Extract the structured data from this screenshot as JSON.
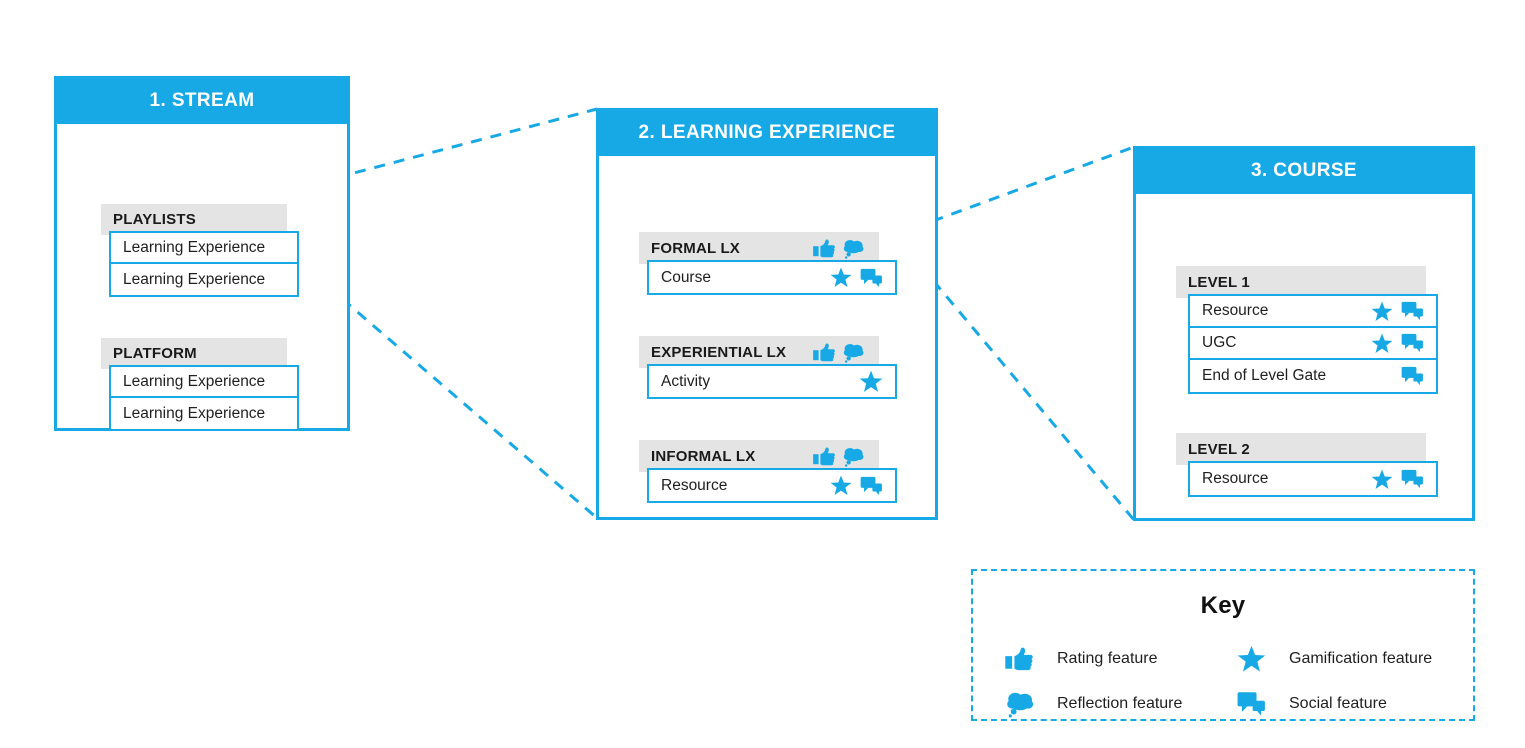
{
  "colors": {
    "brand_blue": "#16A9E6",
    "gray_bar": "#E4E4E4",
    "text_dark": "#1f1f1f",
    "white": "#ffffff"
  },
  "panels": [
    {
      "id": "stream",
      "title": "1. STREAM",
      "groups": [
        {
          "label": "PLAYLISTS",
          "icons": [],
          "items": [
            {
              "text": "Learning Experience",
              "icons": []
            },
            {
              "text": "Learning Experience",
              "icons": []
            }
          ]
        },
        {
          "label": "PLATFORM",
          "icons": [],
          "items": [
            {
              "text": "Learning Experience",
              "icons": []
            },
            {
              "text": "Learning Experience",
              "icons": []
            }
          ]
        }
      ]
    },
    {
      "id": "learning-experience",
      "title": "2. LEARNING EXPERIENCE",
      "groups": [
        {
          "label": "FORMAL LX",
          "icons": [
            "rating-thumbs-up-icon",
            "reflection-cloud-icon"
          ],
          "items": [
            {
              "text": "Course",
              "icons": [
                "gamification-star-icon",
                "social-chat-icon"
              ]
            }
          ]
        },
        {
          "label": "EXPERIENTIAL LX",
          "icons": [
            "rating-thumbs-up-icon",
            "reflection-cloud-icon"
          ],
          "items": [
            {
              "text": "Activity",
              "icons": [
                "gamification-star-icon"
              ]
            }
          ]
        },
        {
          "label": "INFORMAL LX",
          "icons": [
            "rating-thumbs-up-icon",
            "reflection-cloud-icon"
          ],
          "items": [
            {
              "text": "Resource",
              "icons": [
                "gamification-star-icon",
                "social-chat-icon"
              ]
            }
          ]
        }
      ]
    },
    {
      "id": "course",
      "title": "3. COURSE",
      "groups": [
        {
          "label": "LEVEL 1",
          "icons": [],
          "items": [
            {
              "text": "Resource",
              "icons": [
                "gamification-star-icon",
                "social-chat-icon"
              ]
            },
            {
              "text": "UGC",
              "icons": [
                "gamification-star-icon",
                "social-chat-icon"
              ]
            },
            {
              "text": "End of Level Gate",
              "icons": [
                "social-chat-icon"
              ]
            }
          ]
        },
        {
          "label": "LEVEL 2",
          "icons": [],
          "items": [
            {
              "text": "Resource",
              "icons": [
                "gamification-star-icon",
                "social-chat-icon"
              ]
            }
          ]
        }
      ]
    }
  ],
  "key": {
    "title": "Key",
    "entries": [
      {
        "icon": "rating-thumbs-up-icon",
        "label": "Rating feature"
      },
      {
        "icon": "gamification-star-icon",
        "label": "Gamification feature"
      },
      {
        "icon": "reflection-cloud-icon",
        "label": "Reflection feature"
      },
      {
        "icon": "social-chat-icon",
        "label": "Social feature"
      }
    ]
  }
}
